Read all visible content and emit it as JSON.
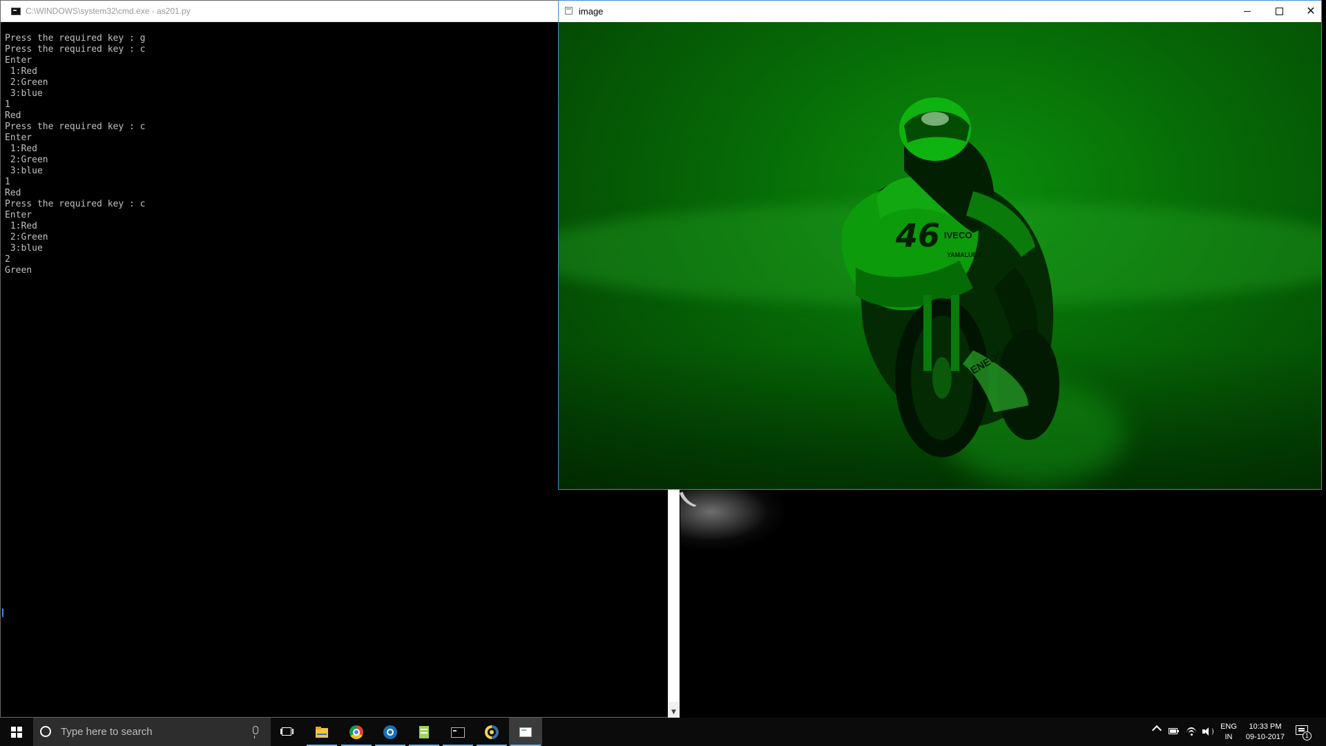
{
  "cmd": {
    "title": "C:\\WINDOWS\\system32\\cmd.exe - as201.py",
    "lines": [
      "Press the required key : g",
      "Press the required key : c",
      "Enter",
      " 1:Red",
      " 2:Green",
      " 3:blue",
      "1",
      "Red",
      "Press the required key : c",
      "Enter",
      " 1:Red",
      " 2:Green",
      " 3:blue",
      "1",
      "Red",
      "Press the required key : c",
      "Enter",
      " 1:Red",
      " 2:Green",
      " 3:blue",
      "2",
      "Green"
    ],
    "scroll_down_glyph": "▼"
  },
  "image_window": {
    "title": "image",
    "tint_color": "#00ff00",
    "close_glyph": "✕",
    "bike_number": "46",
    "bike_sponsors": [
      "IVECO",
      "ENEOS",
      "YAMALUBE"
    ]
  },
  "taskbar": {
    "search_placeholder": "Type here to search",
    "pinned_icons": [
      "task-view-icon",
      "file-explorer-icon",
      "chrome-icon",
      "steam-icon",
      "notepad-icon",
      "cmd-icon",
      "python-icon",
      "image-window-icon"
    ],
    "language_line1": "ENG",
    "language_line2": "IN",
    "time": "10:33 PM",
    "date": "09-10-2017",
    "notification_count": "1"
  }
}
